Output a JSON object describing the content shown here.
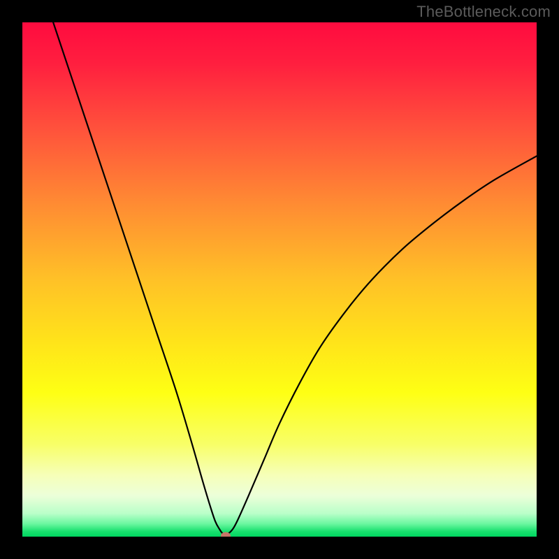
{
  "watermark": "TheBottleneck.com",
  "chart_data": {
    "type": "line",
    "title": "",
    "xlabel": "",
    "ylabel": "",
    "xlim": [
      0,
      100
    ],
    "ylim": [
      0,
      100
    ],
    "gradient_stops": [
      {
        "pos": 0.0,
        "color": "#ff0b3f"
      },
      {
        "pos": 0.08,
        "color": "#ff1f3f"
      },
      {
        "pos": 0.2,
        "color": "#ff4f3c"
      },
      {
        "pos": 0.35,
        "color": "#ff8a33"
      },
      {
        "pos": 0.5,
        "color": "#ffc127"
      },
      {
        "pos": 0.62,
        "color": "#ffe31a"
      },
      {
        "pos": 0.72,
        "color": "#feff14"
      },
      {
        "pos": 0.82,
        "color": "#f8ff67"
      },
      {
        "pos": 0.88,
        "color": "#f6ffb8"
      },
      {
        "pos": 0.92,
        "color": "#ecffd9"
      },
      {
        "pos": 0.955,
        "color": "#baffc9"
      },
      {
        "pos": 0.975,
        "color": "#6bf7a0"
      },
      {
        "pos": 0.99,
        "color": "#18e06e"
      },
      {
        "pos": 1.0,
        "color": "#00d660"
      }
    ],
    "series": [
      {
        "name": "bottleneck-curve",
        "x": [
          6,
          10,
          14,
          18,
          22,
          26,
          30,
          33,
          35,
          36.5,
          37.5,
          38.3,
          39,
          40,
          41,
          42,
          44,
          47,
          50,
          54,
          58,
          63,
          68,
          74,
          80,
          86,
          92,
          100
        ],
        "y": [
          100,
          88,
          76,
          64,
          52,
          40,
          28,
          18,
          11,
          6,
          3,
          1.5,
          0.6,
          0.6,
          1.6,
          3.5,
          8,
          15,
          22,
          30,
          37,
          44,
          50,
          56,
          61,
          65.5,
          69.5,
          74
        ]
      }
    ],
    "marker": {
      "x": 39.5,
      "y": 0.2,
      "color": "#c77468"
    }
  }
}
